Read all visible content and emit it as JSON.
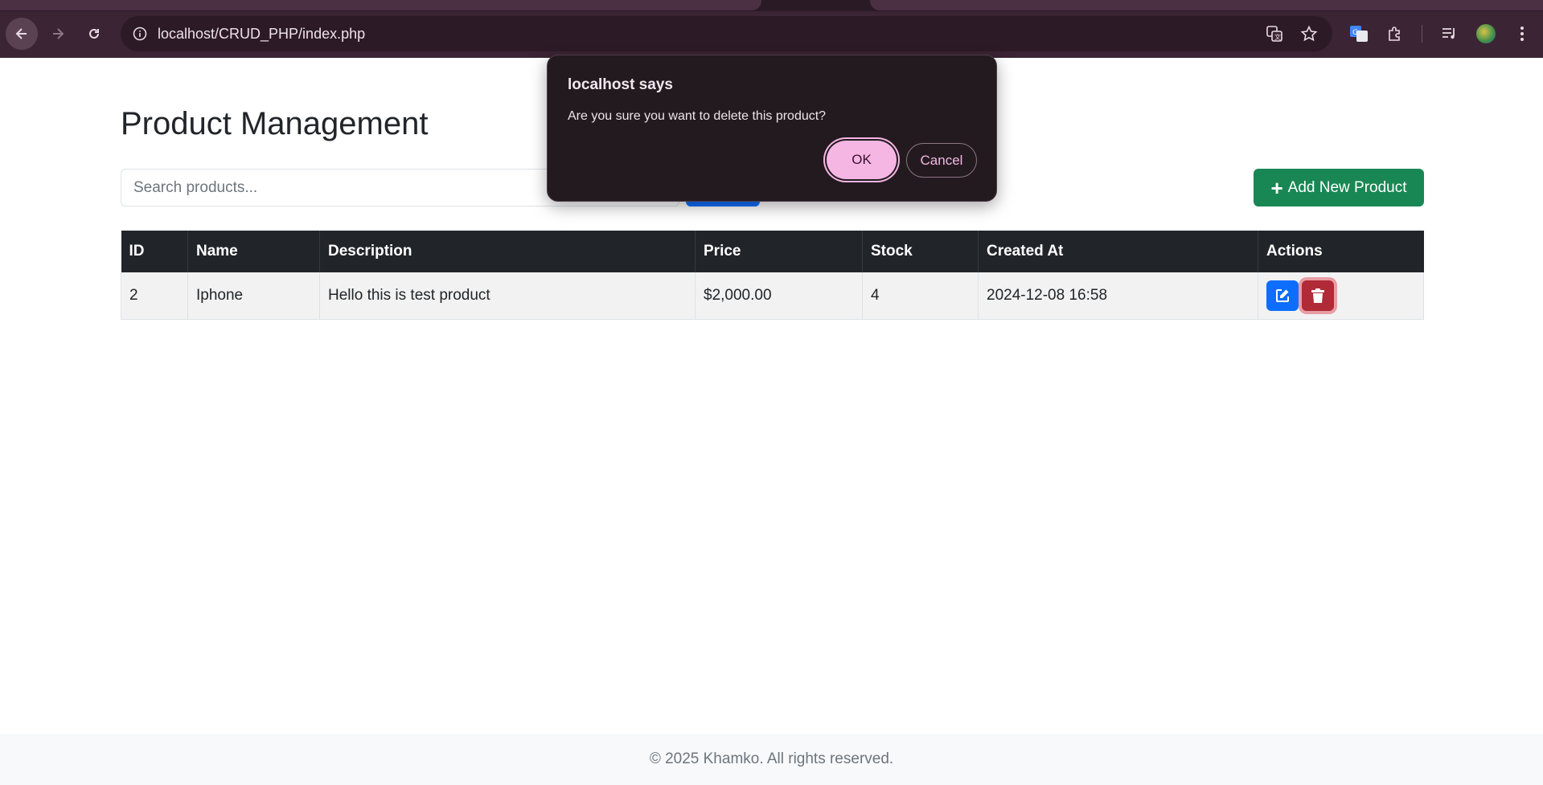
{
  "browser": {
    "url": "localhost/CRUD_PHP/index.php"
  },
  "page": {
    "title": "Product Management",
    "search_placeholder": "Search products...",
    "search_button_label": "",
    "add_button_label": "Add New Product",
    "add_button_icon": "plus-icon"
  },
  "table": {
    "columns": [
      "ID",
      "Name",
      "Description",
      "Price",
      "Stock",
      "Created At",
      "Actions"
    ],
    "rows": [
      {
        "id": "2",
        "name": "Iphone",
        "description": "Hello this is test product",
        "price": "$2,000.00",
        "stock": "4",
        "created_at": "2024-12-08 16:58",
        "actions": [
          "edit-icon",
          "trash-icon"
        ]
      }
    ]
  },
  "dialog": {
    "title": "localhost says",
    "message": "Are you sure you want to delete this product?",
    "ok_label": "OK",
    "cancel_label": "Cancel"
  },
  "footer": {
    "text": "© 2025 Khamko. All rights reserved."
  },
  "colors": {
    "primary": "#0d6efd",
    "success": "#198754",
    "danger": "#b02a37",
    "table_header": "#212529",
    "dialog_accent": "#f6b6e3"
  }
}
